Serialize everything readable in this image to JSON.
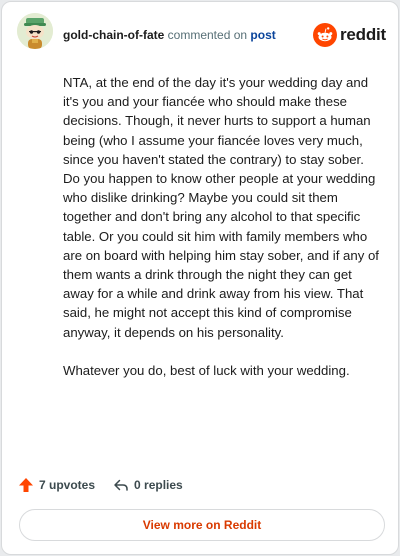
{
  "header": {
    "username": "gold-chain-of-fate",
    "verb": "commented on",
    "target": "post",
    "brand": "reddit"
  },
  "avatar": {
    "icon": "snoo-avatar-icon"
  },
  "comment": {
    "paragraphs": [
      "NTA, at the end of the day it's your wedding day and it's you and your fiancée who should make these decisions. Though, it never hurts to support a human being (who I assume your fiancée loves very much, since you haven't stated the contrary) to stay sober. Do you happen to know other people at your wedding who dislike drinking? Maybe you could sit them together and don't bring any alcohol to that specific table. Or you could sit him with family members who are on board with helping him stay sober, and if any of them wants a drink through the night they can get away for a while and drink away from his view. That said, he might not accept this kind of compromise anyway, it depends on his personality.",
      "Whatever you do, best of luck with your wedding."
    ]
  },
  "actions": {
    "upvotes": "7 upvotes",
    "replies": "0 replies"
  },
  "footer": {
    "view_more": "View more on Reddit"
  },
  "colors": {
    "brand_orange": "#ff4500",
    "link_blue": "#0a449b",
    "cta_orange": "#d93a00"
  }
}
